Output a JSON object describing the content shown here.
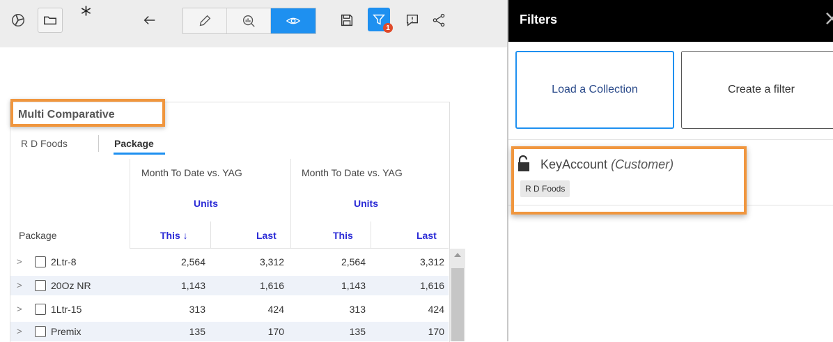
{
  "toolbar": {
    "icons": [
      "fan-icon",
      "folder-icon",
      "back-arrow-icon",
      "pencil-icon",
      "chart-search-icon",
      "eye-icon",
      "save-icon",
      "filter-icon",
      "feedback-icon",
      "share-icon"
    ],
    "modified_marker": "*",
    "filter_badge": "1",
    "accent": "#1e90f0"
  },
  "card": {
    "title": "Multi Comparative",
    "tabs": [
      {
        "label": "R D Foods",
        "active": false
      },
      {
        "label": "Package",
        "active": true
      }
    ],
    "column_groups": [
      {
        "period": "Month To Date vs. YAG",
        "measure": "Units"
      },
      {
        "period": "Month To Date vs. YAG",
        "measure": "Units"
      }
    ],
    "row_header": "Package",
    "columns": [
      "This ↓",
      "Last",
      "This",
      "Last"
    ],
    "rows": [
      {
        "name": "2Ltr-8",
        "values": [
          "2,564",
          "3,312",
          "2,564",
          "3,312"
        ]
      },
      {
        "name": "20Oz NR",
        "values": [
          "1,143",
          "1,616",
          "1,143",
          "1,616"
        ]
      },
      {
        "name": "1Ltr-15",
        "values": [
          "313",
          "424",
          "313",
          "424"
        ]
      },
      {
        "name": "Premix",
        "values": [
          "135",
          "170",
          "135",
          "170"
        ]
      }
    ],
    "expand_glyph": ">"
  },
  "filters": {
    "title": "Filters",
    "close": "×",
    "load_collection": "Load a Collection",
    "create_filter": "Create a filter",
    "key": "KeyAccount",
    "key_dim": "(Customer)",
    "chip": "R D Foods"
  },
  "highlight_color": "#f0963e"
}
